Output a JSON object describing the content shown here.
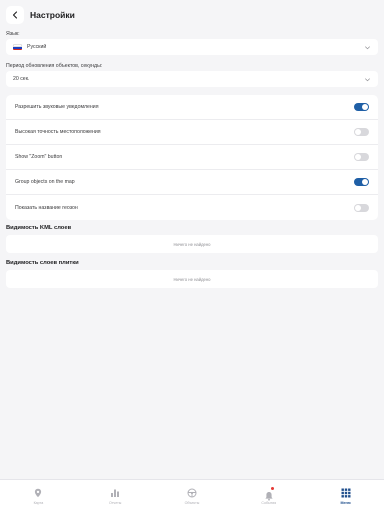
{
  "header": {
    "title": "Настройки"
  },
  "language": {
    "label": "Язык:",
    "value": "Русский",
    "flag_colors": [
      "#ffffff",
      "#1c3fbf",
      "#d52b1e"
    ]
  },
  "refresh": {
    "label": "Период обновления объектов, секунды:",
    "value": "20 сек."
  },
  "toggles": [
    {
      "label": "Разрешить звуковые уведомления",
      "on": true
    },
    {
      "label": "Высокая точность местоположения",
      "on": false
    },
    {
      "label": "Show \"Zoom\" button",
      "on": false
    },
    {
      "label": "Group objects on the map",
      "on": true
    },
    {
      "label": "Показать название геозон",
      "on": false
    }
  ],
  "kml_section": {
    "title": "Видимость KML слоев",
    "empty_text": "Ничего не найдено"
  },
  "tile_section": {
    "title": "Видимость слоев плитки",
    "empty_text": "Ничего не найдено"
  },
  "tabbar": {
    "tabs": [
      {
        "label": "Карта",
        "icon": "map-pin-icon",
        "active": false
      },
      {
        "label": "Отчеты",
        "icon": "bar-chart-icon",
        "active": false
      },
      {
        "label": "Объекты",
        "icon": "steering-wheel-icon",
        "active": false
      },
      {
        "label": "События",
        "icon": "bell-icon",
        "active": false
      },
      {
        "label": "Меню",
        "icon": "grid-icon",
        "active": true
      }
    ]
  },
  "colors": {
    "accent": "#1f5fa6",
    "active_tab": "#1f4e8c",
    "background": "#f5f5f7"
  }
}
